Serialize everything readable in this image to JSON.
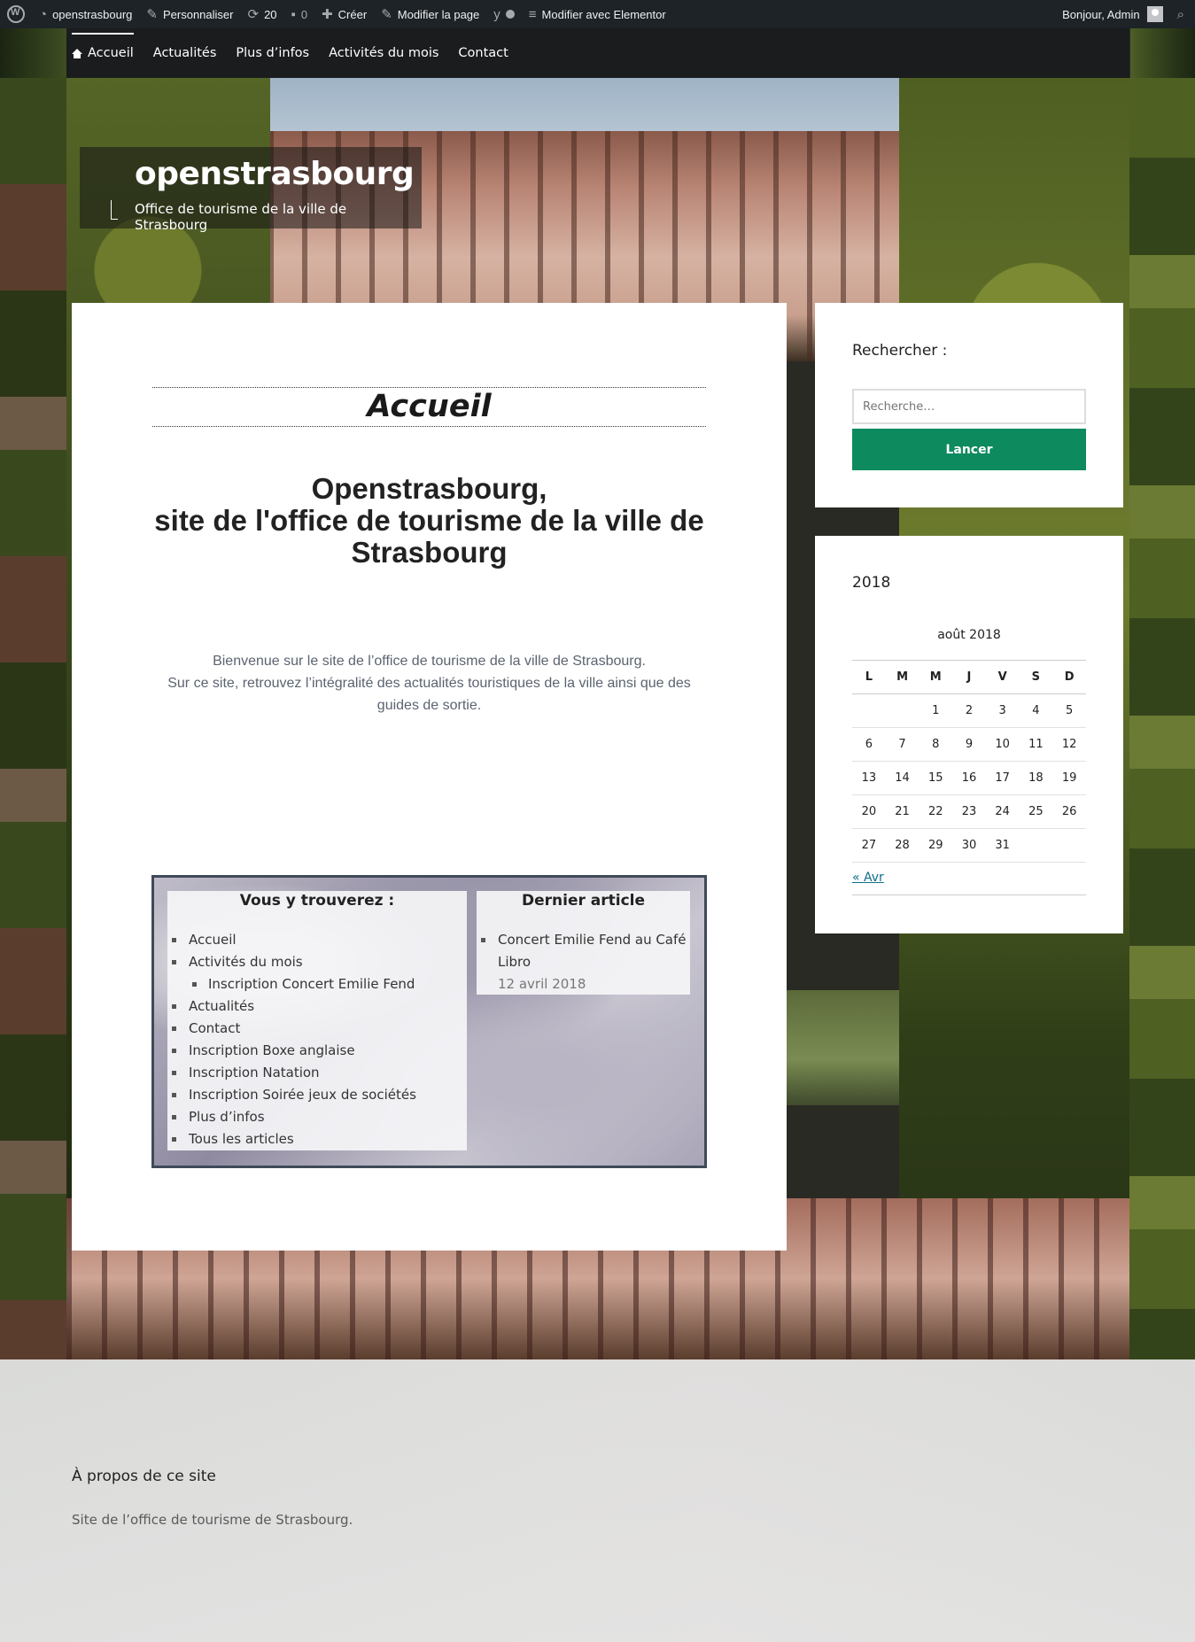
{
  "admin_bar": {
    "site_name": "openstrasbourg",
    "customize": "Personnaliser",
    "updates_count": "20",
    "comments_count": "0",
    "new": "Créer",
    "edit_page": "Modifier la page",
    "elementor": "Modifier avec Elementor",
    "greeting": "Bonjour, Admin"
  },
  "nav": {
    "items": [
      "Accueil",
      "Actualités",
      "Plus d’infos",
      "Activités du mois",
      "Contact"
    ],
    "active": "Accueil"
  },
  "site": {
    "title": "openstrasbourg",
    "description": "Office de tourisme de la ville de Strasbourg"
  },
  "page": {
    "title": "Accueil",
    "heading_line1": "Openstrasbourg,",
    "heading_line2": "site de l'office de tourisme de la ville de Strasbourg",
    "intro_line1": "Bienvenue sur le site de l’office de tourisme de la ville de Strasbourg.",
    "intro_line2": "Sur ce site, retrouvez l’intégralité des actualités touristiques de la ville ainsi que des guides de sortie."
  },
  "widgets": {
    "pages_title": "Vous y trouverez :",
    "pages": [
      {
        "label": "Accueil",
        "sub": false
      },
      {
        "label": "Activités du mois",
        "sub": false
      },
      {
        "label": "Inscription Concert Emilie Fend",
        "sub": true
      },
      {
        "label": "Actualités",
        "sub": false
      },
      {
        "label": "Contact",
        "sub": false
      },
      {
        "label": "Inscription Boxe anglaise",
        "sub": false
      },
      {
        "label": "Inscription Natation",
        "sub": false
      },
      {
        "label": "Inscription Soirée jeux de sociétés",
        "sub": false
      },
      {
        "label": "Plus d’infos",
        "sub": false
      },
      {
        "label": "Tous les articles",
        "sub": false
      }
    ],
    "recent_title": "Dernier article",
    "recent_post": "Concert Emilie Fend au Café Libro",
    "recent_date": "12 avril 2018"
  },
  "sidebar": {
    "search_title": "Rechercher :",
    "search_placeholder": "Recherche…",
    "search_button": "Lancer",
    "calendar_title": "2018",
    "calendar_caption": "août 2018",
    "weekdays": [
      "L",
      "M",
      "M",
      "J",
      "V",
      "S",
      "D"
    ],
    "weeks": [
      [
        "",
        "",
        "1",
        "2",
        "3",
        "4",
        "5"
      ],
      [
        "6",
        "7",
        "8",
        "9",
        "10",
        "11",
        "12"
      ],
      [
        "13",
        "14",
        "15",
        "16",
        "17",
        "18",
        "19"
      ],
      [
        "20",
        "21",
        "22",
        "23",
        "24",
        "25",
        "26"
      ],
      [
        "27",
        "28",
        "29",
        "30",
        "31",
        "",
        ""
      ]
    ],
    "prev_link": "« Avr"
  },
  "footer": {
    "title": "À propos de ce site",
    "text": "Site de l’office de tourisme de Strasbourg."
  },
  "colors": {
    "admin_bar": "#1d2327",
    "nav": "#1a1c1d",
    "button": "#0e8a5f",
    "link": "#0d6e8a"
  }
}
